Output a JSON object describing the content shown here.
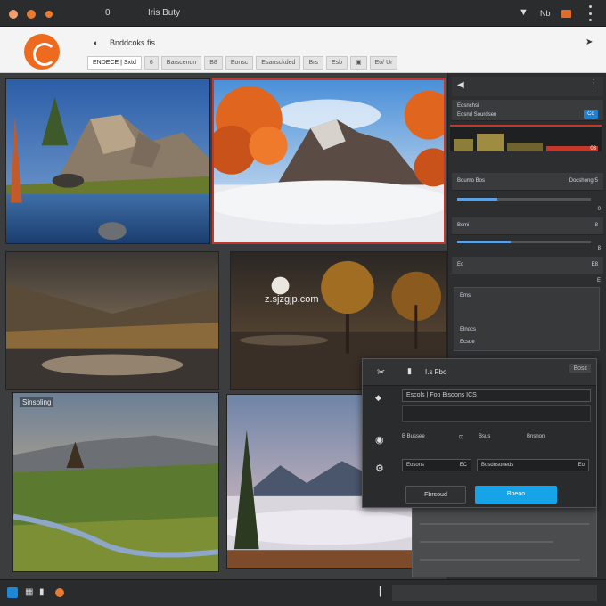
{
  "window": {
    "tab_counter": "0",
    "title": "Iris Buty",
    "toolbar_label": "Nb",
    "icons": [
      "traffic-light-close",
      "traffic-light-minimize",
      "traffic-light-zoom",
      "download-arrow-icon",
      "folder-icon",
      "more-vertical-icon"
    ]
  },
  "toolbar": {
    "address": "Bnddcoks fis",
    "tabs": [
      {
        "label": "ENDECE | Sxtd",
        "active": true
      },
      {
        "label": "6",
        "active": false
      },
      {
        "label": "Barscenon",
        "active": false
      },
      {
        "label": "B8",
        "active": false
      },
      {
        "label": "Eonsc",
        "active": false
      },
      {
        "label": "Esansckded",
        "active": false
      },
      {
        "label": "Brs",
        "active": false
      },
      {
        "label": "Esb",
        "active": false
      },
      {
        "label": "▣",
        "active": false
      },
      {
        "label": "Eo/ Ur",
        "active": false
      }
    ]
  },
  "gallery": {
    "watermark": "z.sjzgjp.com",
    "p5_label": "Sinsbling"
  },
  "right_panel": {
    "rows": [
      {
        "label": "Eosnchsi",
        "value": ""
      },
      {
        "label": "Eosnd Sourdsen",
        "value": "Co"
      },
      {
        "label": "",
        "value": "03"
      },
      {
        "label": "Boumo Bos",
        "value": "Docshongr5"
      },
      {
        "label": "",
        "value": "0"
      },
      {
        "label": "Bsmi",
        "value": "8"
      },
      {
        "label": "",
        "value": "8"
      },
      {
        "label": "Eo",
        "value": "E8"
      },
      {
        "label": "",
        "value": "E"
      },
      {
        "label": "Ems",
        "value": ""
      },
      {
        "label": "Elnocs",
        "value": ""
      }
    ],
    "bottom_label": "Ecsde"
  },
  "dialog": {
    "title": "I.s Fbo",
    "close_label": "Bosc",
    "field1": "Escols | Foo Bisoons ICS",
    "section_label": "B Bussee",
    "section_value": "Bsus",
    "section_value2": "Bnsnon",
    "input1_label": "Eosons",
    "input1_value": "EC",
    "input2_label": "Bosdnsoneds",
    "input2_value": "Eo",
    "cancel_label": "Fbrsoud",
    "ok_label": "Bbeoo"
  },
  "colors": {
    "accent": "#16a3e8",
    "brand": "#ee6a1f",
    "panel": "#2d2e30"
  }
}
